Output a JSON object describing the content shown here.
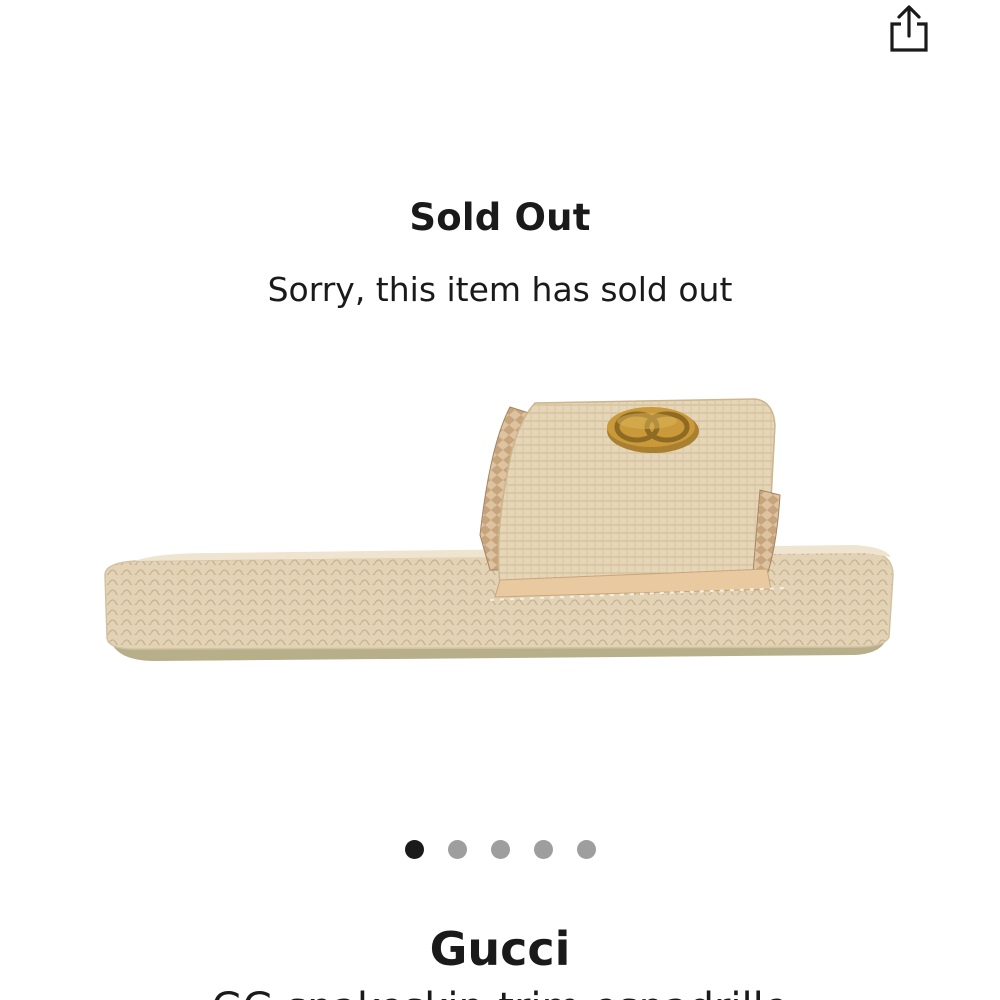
{
  "header": {
    "share_icon": "share-icon"
  },
  "status": {
    "title": "Sold Out",
    "message": "Sorry, this item has sold out"
  },
  "gallery": {
    "image_icon": "espadrille-slide-sandal",
    "image_count": 5,
    "active_index": 0
  },
  "product": {
    "brand": "Gucci",
    "name": "GG snakeskin-trim espadrille"
  },
  "colors": {
    "dot_active": "#1a1a1a",
    "dot_inactive": "#9e9e9e",
    "raffia": "#e3d2b4",
    "logo_gold": "#c9993a"
  }
}
